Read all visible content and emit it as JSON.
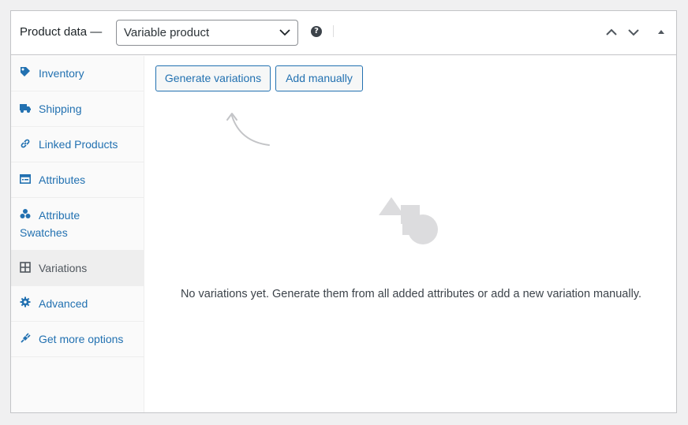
{
  "header": {
    "title": "Product data —",
    "product_type": "Variable product",
    "help_glyph": "?"
  },
  "sidebar": {
    "items": [
      {
        "label": "Inventory",
        "icon": "tag-icon"
      },
      {
        "label": "Shipping",
        "icon": "truck-icon"
      },
      {
        "label": "Linked Products",
        "icon": "link-icon"
      },
      {
        "label": "Attributes",
        "icon": "list-icon"
      },
      {
        "label_line1": "Attribute",
        "label_line2": "Swatches",
        "icon": "swatches-icon"
      },
      {
        "label": "Variations",
        "icon": "grid-icon",
        "active": true
      },
      {
        "label": "Advanced",
        "icon": "gear-icon"
      },
      {
        "label": "Get more options",
        "icon": "plug-icon"
      }
    ]
  },
  "main": {
    "generate_button": "Generate variations",
    "add_button": "Add manually",
    "empty_message": "No variations yet. Generate them from all added attributes or add a new variation manually."
  },
  "colors": {
    "accent": "#2271b1",
    "border": "#c3c4c7",
    "active_tab_bg": "#eeeeee",
    "placeholder_shapes": "#dcdcde"
  }
}
